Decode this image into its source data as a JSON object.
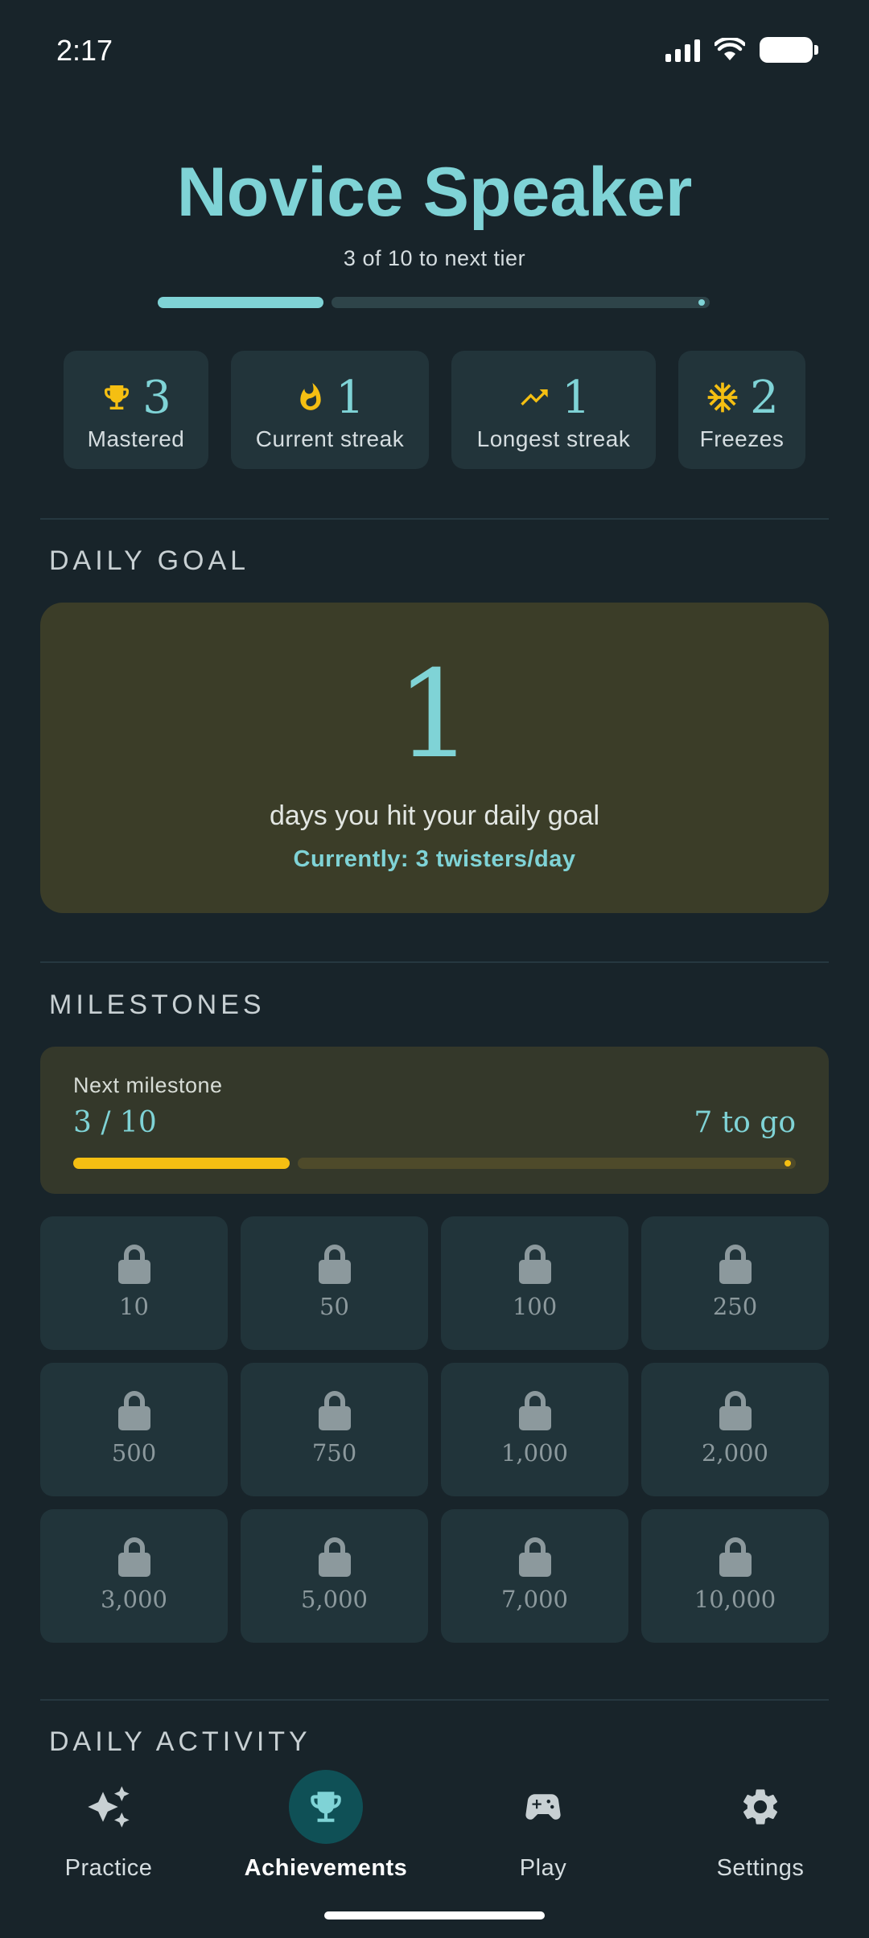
{
  "status_bar": {
    "time": "2:17"
  },
  "tier": {
    "title": "Novice Speaker",
    "subtitle": "3 of 10 to next tier",
    "progress": 0.3
  },
  "stats": [
    {
      "icon": "trophy-icon",
      "value": "3",
      "label": "Mastered"
    },
    {
      "icon": "flame-icon",
      "value": "1",
      "label": "Current streak"
    },
    {
      "icon": "trending-up-icon",
      "value": "1",
      "label": "Longest streak"
    },
    {
      "icon": "snowflake-icon",
      "value": "2",
      "label": "Freezes"
    }
  ],
  "daily_goal": {
    "section_title": "DAILY GOAL",
    "count": "1",
    "description": "days you hit your daily goal",
    "current": "Currently: 3 twisters/day"
  },
  "milestones": {
    "section_title": "MILESTONES",
    "next_label": "Next milestone",
    "progress_text": "3 / 10",
    "to_go": "7 to go",
    "progress": 0.3,
    "tiles": [
      "10",
      "50",
      "100",
      "250",
      "500",
      "750",
      "1,000",
      "2,000",
      "3,000",
      "5,000",
      "7,000",
      "10,000"
    ]
  },
  "daily_activity": {
    "section_title": "DAILY ACTIVITY"
  },
  "nav": {
    "items": [
      {
        "label": "Practice",
        "icon": "sparkles-icon"
      },
      {
        "label": "Achievements",
        "icon": "trophy-icon"
      },
      {
        "label": "Play",
        "icon": "gamepad-icon"
      },
      {
        "label": "Settings",
        "icon": "gear-icon"
      }
    ],
    "active_index": 1
  },
  "colors": {
    "background": "#18242a",
    "accent_teal": "#7fd3d6",
    "accent_yellow": "#f5bf12",
    "card": "#22343a"
  }
}
